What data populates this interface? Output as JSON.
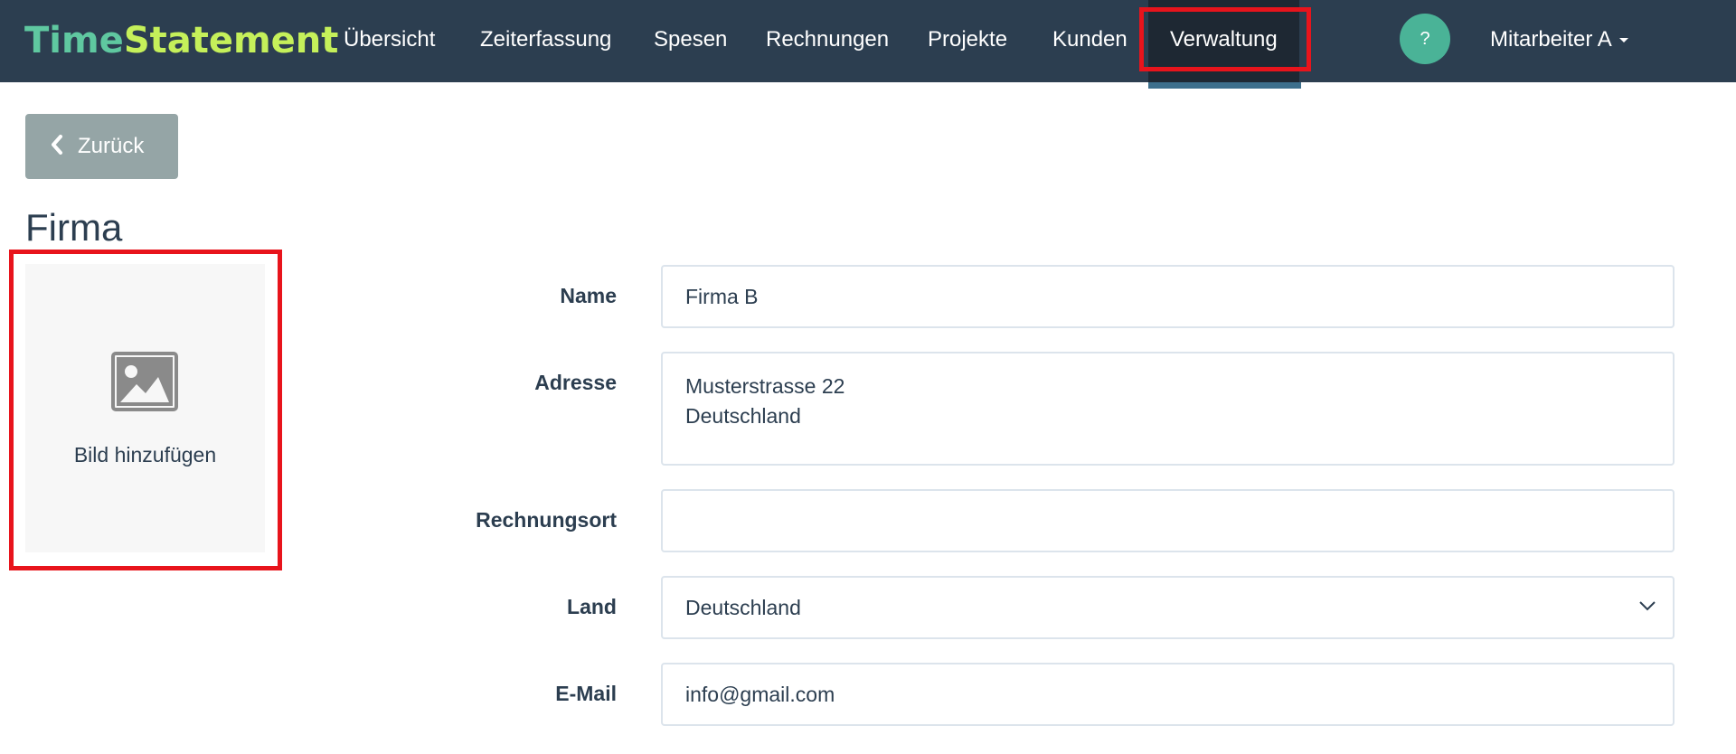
{
  "navbar": {
    "brand_part1": "Time",
    "brand_part2": "Statement",
    "items": [
      {
        "label": "Übersicht"
      },
      {
        "label": "Zeiterfassung"
      },
      {
        "label": "Spesen"
      },
      {
        "label": "Rechnungen"
      },
      {
        "label": "Projekte"
      },
      {
        "label": "Kunden"
      },
      {
        "label": "Verwaltung",
        "active": true
      }
    ],
    "help_label": "?",
    "user_label": "Mitarbeiter A"
  },
  "back_button": {
    "label": "Zurück",
    "icon": "chevron-left-icon"
  },
  "page_title": "Firma",
  "image_placeholder": {
    "label": "Bild hinzufügen",
    "icon": "image-icon"
  },
  "form": {
    "name": {
      "label": "Name",
      "value": "Firma B"
    },
    "address": {
      "label": "Adresse",
      "value": "Musterstrasse 22\nDeutschland"
    },
    "billing_place": {
      "label": "Rechnungsort",
      "value": ""
    },
    "country": {
      "label": "Land",
      "value": "Deutschland"
    },
    "email": {
      "label": "E-Mail",
      "value": "info@gmail.com"
    }
  },
  "colors": {
    "navbar_bg": "#2c3e50",
    "brand_time": "#5fc8a0",
    "brand_statement": "#c5f05a",
    "help_circle": "#4ab397",
    "back_button": "#95a5a6",
    "highlight": "#e8141c"
  }
}
